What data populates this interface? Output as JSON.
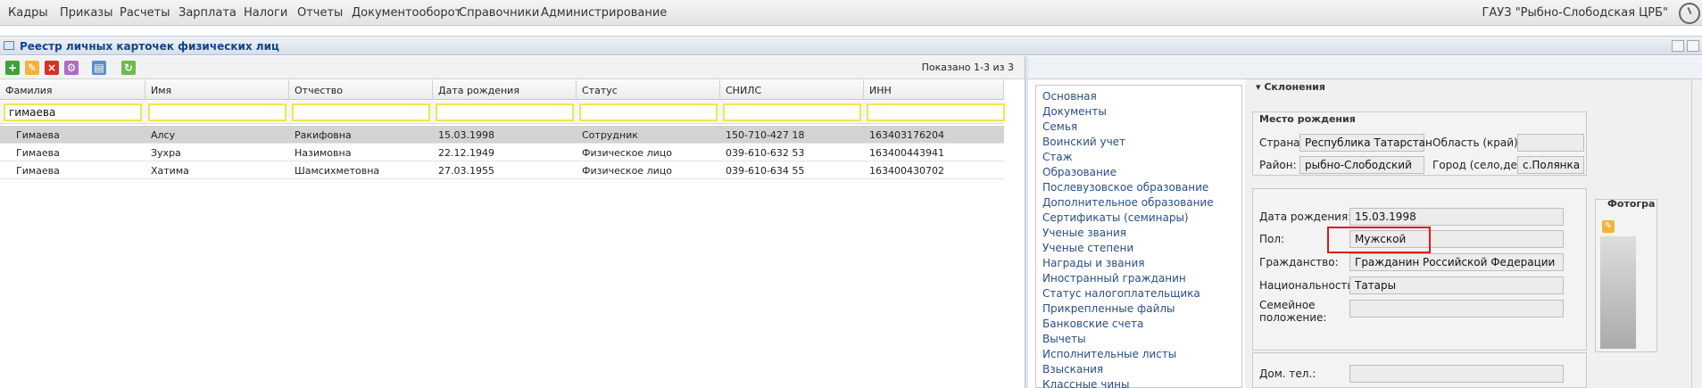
{
  "menu": {
    "items": [
      "Кадры",
      "Приказы",
      "Расчеты",
      "Зарплата",
      "Налоги",
      "Отчеты",
      "Документооборот",
      "Справочники",
      "Администрирование"
    ],
    "org": "ГАУЗ \"Рыбно-Слободская ЦРБ\""
  },
  "panel": {
    "title": "Реестр личных карточек физических лиц"
  },
  "toolbar": {
    "shown": "Показано 1-3 из 3"
  },
  "grid": {
    "columns": [
      "Фамилия",
      "Имя",
      "Отчество",
      "Дата рождения",
      "Статус",
      "СНИЛС",
      "ИНН"
    ],
    "filter_surname": "гимаева",
    "rows": [
      [
        "Гимаева",
        "Алсу",
        "Ракифовна",
        "15.03.1998",
        "Сотрудник",
        "150-710-427 18",
        "163403176204"
      ],
      [
        "Гимаева",
        "Зухра",
        "Назимовна",
        "22.12.1949",
        "Физическое лицо",
        "039-610-632 53",
        "163400443941"
      ],
      [
        "Гимаева",
        "Хатима",
        "Шамсихметовна",
        "27.03.1955",
        "Физическое лицо",
        "039-610-634 55",
        "163400430702"
      ]
    ]
  },
  "nav": {
    "items": [
      "Основная",
      "Документы",
      "Семья",
      "Воинский учет",
      "Стаж",
      "Образование",
      "Послевузовское образование",
      "Дополнительное образование",
      "Сертификаты (семинары)",
      "Ученые звания",
      "Ученые степени",
      "Награды и звания",
      "Иностранный гражданин",
      "Статус налогоплательщика",
      "Прикрепленные файлы",
      "Банковские счета",
      "Вычеты",
      "Исполнительные листы",
      "Взыскания",
      "Классные чины"
    ]
  },
  "details": {
    "declensions": "Склонения",
    "birthplace": {
      "legend": "Место рождения",
      "country_label": "Страна:",
      "country": "Республика Татарстан",
      "region_label": "Область (край):",
      "region": "",
      "district_label": "Район:",
      "district": "рыбно-Слободский",
      "city_label": "Город (село,дер.):",
      "city": "с.Полянка"
    },
    "birthdate_label": "Дата рождения:",
    "birthdate": "15.03.1998",
    "gender_label": "Пол:",
    "gender": "Мужской",
    "citizenship_label": "Гражданство:",
    "citizenship": "Гражданин Российской Федерации",
    "nationality_label": "Национальность:",
    "nationality": "Татары",
    "marital_label_1": "Семейное",
    "marital_label_2": "положение:",
    "marital": "",
    "phone_label": "Дом. тел.:",
    "phone": "",
    "photo_label": "Фотогра"
  }
}
